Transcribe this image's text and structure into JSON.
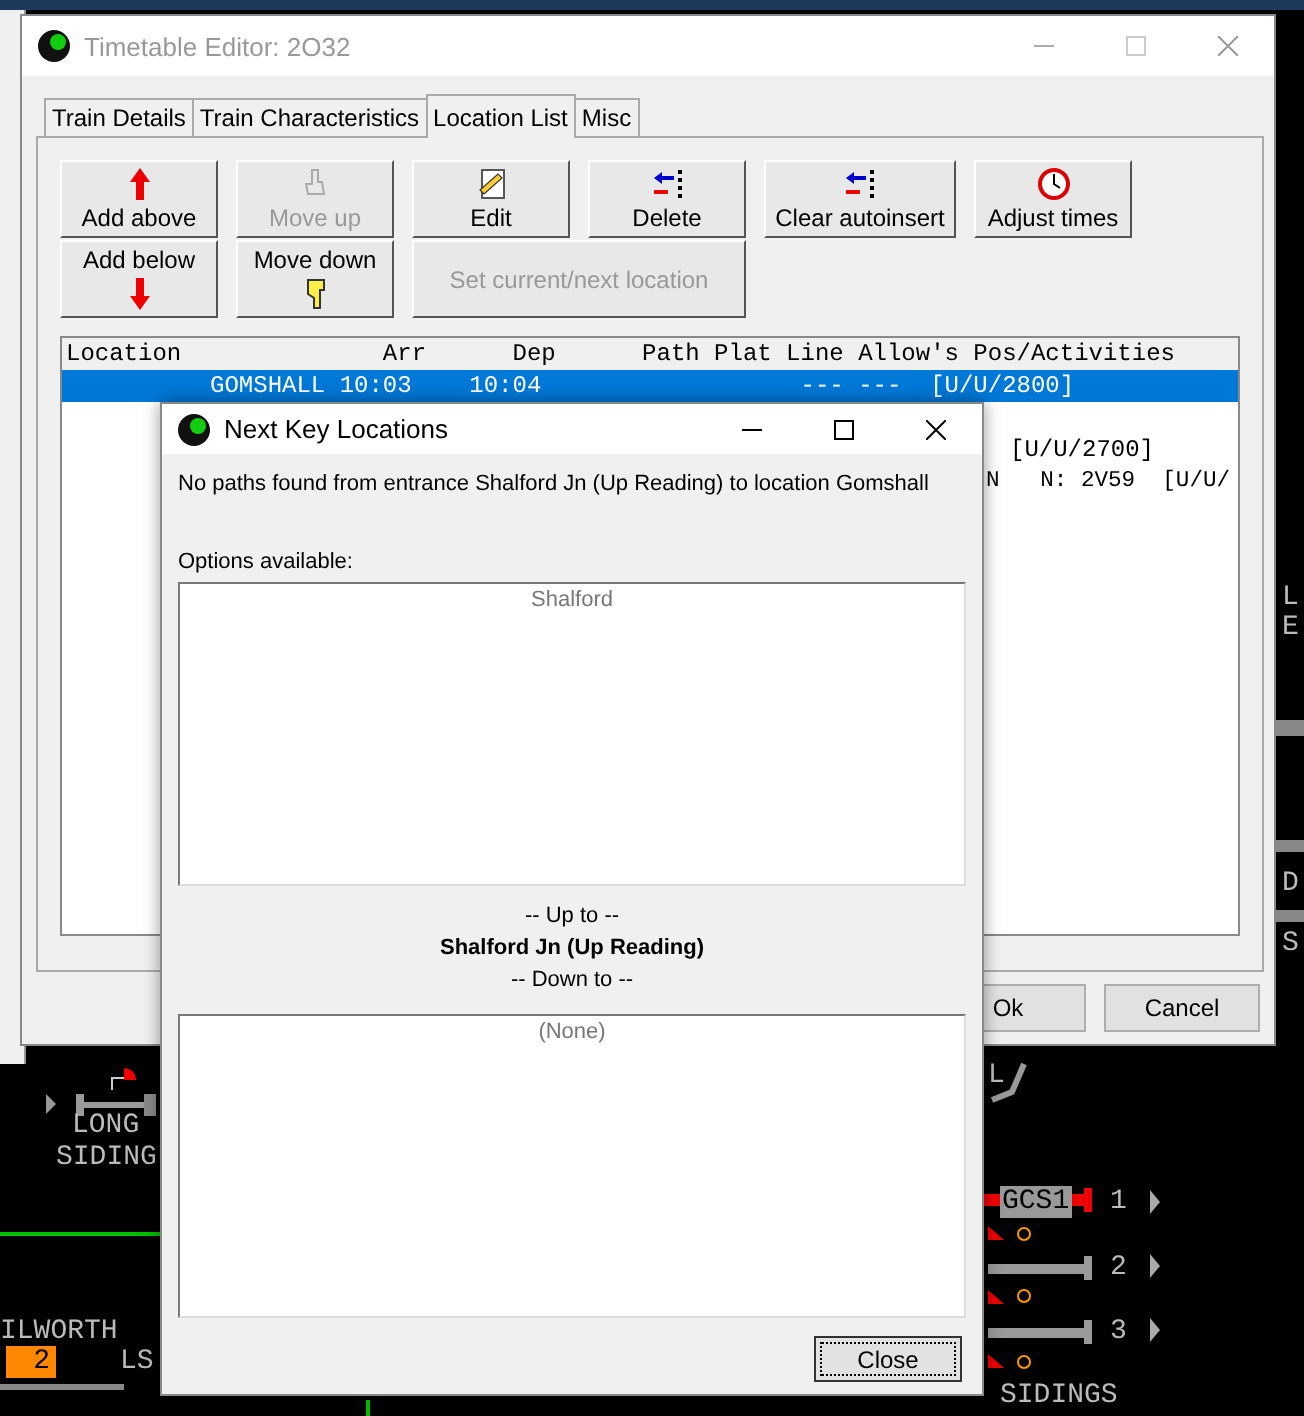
{
  "main_window": {
    "title": "Timetable Editor: 2O32",
    "tabs": [
      {
        "label": "Train Details",
        "selected": false
      },
      {
        "label": "Train Characteristics",
        "selected": false
      },
      {
        "label": "Location List",
        "selected": true
      },
      {
        "label": "Misc",
        "selected": false
      }
    ],
    "buttons": [
      {
        "label": "Add above",
        "kind": "up",
        "disabled": false
      },
      {
        "label": "Move up",
        "kind": "hand",
        "disabled": true
      },
      {
        "label": "Edit",
        "kind": "edit",
        "disabled": false
      },
      {
        "label": "Delete",
        "kind": "delete",
        "disabled": false
      },
      {
        "label": "Clear autoinsert",
        "kind": "delete",
        "disabled": false
      },
      {
        "label": "Adjust times",
        "kind": "clock",
        "disabled": false
      },
      {
        "label": "Add below",
        "kind": "down",
        "disabled": false
      },
      {
        "label": "Move down",
        "kind": "handdown",
        "disabled": false
      },
      {
        "label": "Set current/next location",
        "kind": "text",
        "disabled": true
      }
    ],
    "list": {
      "header": "Location              Arr      Dep      Path Plat Line Allow's Pos/Activities",
      "rows": [
        {
          "text": "          GOMSHALL 10:03    10:04                  --- ---  [U/U/2800]",
          "selected": true
        },
        {
          "text": "[U/U/2700]",
          "selected": false
        },
        {
          "text": "N   N: 2V59  [U/U/",
          "selected": false
        }
      ]
    },
    "buttons_bottom": [
      "Ok",
      "Cancel"
    ]
  },
  "dialog": {
    "title": "Next Key Locations",
    "message": "No paths found from entrance Shalford Jn (Up Reading) to location Gomshall",
    "options_label": "Options available:",
    "options": [
      "Shalford"
    ],
    "up_to_label": "-- Up to --",
    "current": "Shalford Jn (Up Reading)",
    "down_to_label": "-- Down to --",
    "down_options": [
      "(None)"
    ],
    "close": "Close"
  },
  "diagram": {
    "labels": [
      "LONG",
      "SIDING",
      "ILWORTH",
      "2",
      "LS",
      "GCS1",
      "1",
      "2",
      "3",
      "SIDINGS",
      "L",
      "E",
      "D",
      "S",
      "L"
    ]
  }
}
